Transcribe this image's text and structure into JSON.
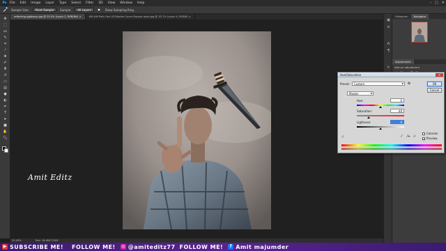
{
  "app": {
    "logo": "Ps",
    "menu": [
      "File",
      "Edit",
      "Image",
      "Layer",
      "Type",
      "Select",
      "Filter",
      "3D",
      "View",
      "Window",
      "Help"
    ],
    "window_controls": [
      "–",
      "□",
      "✕"
    ]
  },
  "options_bar": {
    "tool_icon": "eyedropper-icon",
    "sample_size_label": "Sample Size:",
    "sample_size_value": "Point Sample",
    "sample_label": "Sample:",
    "sample_value": "All Layers",
    "show_ring": "Show Sampling Ring"
  },
  "tabs": [
    {
      "label": "reflecting-gqjdsoyo.jpg @ 25.5% (Layer 2, RGB/8#) ×",
      "active": true
    },
    {
      "label": "KM IAM Path Gen VS Blocket Cover Popular book.jpg @ 33.7% (Layer 4, RGB/8) ×",
      "active": false
    }
  ],
  "status": {
    "zoom": "25.49%",
    "doc": "Doc: 18.4M/73.0M"
  },
  "watermark": "Amit Editz",
  "panels": {
    "tabs": [
      "Histogram",
      "Navigator"
    ],
    "adjustments_title": "Adjustments",
    "adjustments_hint": "Add an adjustment"
  },
  "dialog": {
    "title": "Hue/Saturation",
    "close": "✕",
    "preset_label": "Preset:",
    "preset_value": "Custom",
    "channel_value": "Master",
    "hue_label": "Hue:",
    "hue_value": "0",
    "saturation_label": "Saturation:",
    "saturation_value": "-49",
    "lightness_label": "Lightness:",
    "lightness_value": "0",
    "ok_label": "OK",
    "cancel_label": "Cancel",
    "colorize_label": "Colorize",
    "preview_label": "Preview",
    "preview_checked": true,
    "colorize_checked": false,
    "hue_level": 0.5,
    "saturation_level": 0.255,
    "lightness_level": 0.5
  },
  "banner": {
    "subscribe": "SUBSCRIBE ME!",
    "follow1": "FOLLOW ME!",
    "handle": "@amiteditz77",
    "follow2": "FOLLOW ME!",
    "name": "Amit majumder",
    "colors": {
      "youtube": "#e53935",
      "instagram": "#d6249f",
      "facebook": "#1877f2",
      "text": "#ffffff"
    }
  }
}
